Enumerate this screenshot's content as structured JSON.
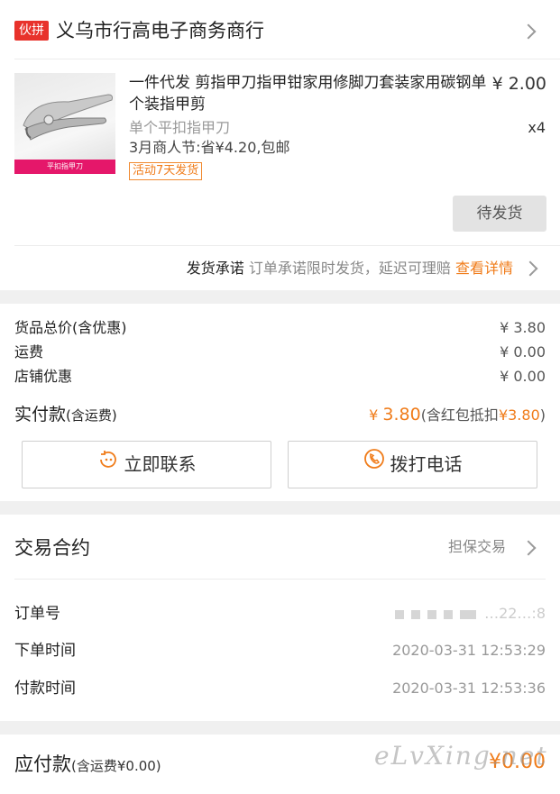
{
  "shop": {
    "badge": "伙拼",
    "name": "义乌市行高电子商务商行"
  },
  "product": {
    "thumb_caption": "平扣指甲刀",
    "title": "一件代发 剪指甲刀指甲钳家用修脚刀套装家用碳钢单个装指甲剪",
    "price": "¥ 2.00",
    "spec": "单个平扣指甲刀",
    "qty": "x4",
    "promo": "3月商人节:省¥4.20,包邮",
    "tag": "活动7天发货"
  },
  "status_button": "待发货",
  "promise": {
    "label": "发货承诺",
    "text": " 订单承诺限时发货，延迟可理赔 ",
    "link": "查看详情"
  },
  "summary": {
    "rows": [
      {
        "label": "货品总价(含优惠)",
        "value": "¥ 3.80"
      },
      {
        "label": "运费",
        "value": "¥ 0.00"
      },
      {
        "label": "店铺优惠",
        "value": "¥ 0.00"
      }
    ],
    "paid_label": "实付款",
    "paid_label_note": "(含运费)",
    "paid_amount_symbol": "¥ ",
    "paid_amount": "3.80",
    "paid_note_prefix": "(含红包抵扣",
    "paid_note_amount": "¥3.80",
    "paid_note_suffix": ")"
  },
  "actions": {
    "contact": "立即联系",
    "call": "拨打电话"
  },
  "contract": {
    "title": "交易合约",
    "type": "担保交易",
    "order_no_label": "订单号",
    "order_no_value": "…22…:8",
    "order_time_label": "下单时间",
    "order_time_value": "2020-03-31 12:53:29",
    "pay_time_label": "付款时间",
    "pay_time_value": "2020-03-31 12:53:36"
  },
  "bottom": {
    "due_label": "应付款",
    "due_note": "(含运费¥0.00)",
    "due_value": "¥0.00"
  },
  "watermark": "eLvXing.net",
  "colors": {
    "accent": "#f07c1a",
    "badge": "#e8322b"
  }
}
